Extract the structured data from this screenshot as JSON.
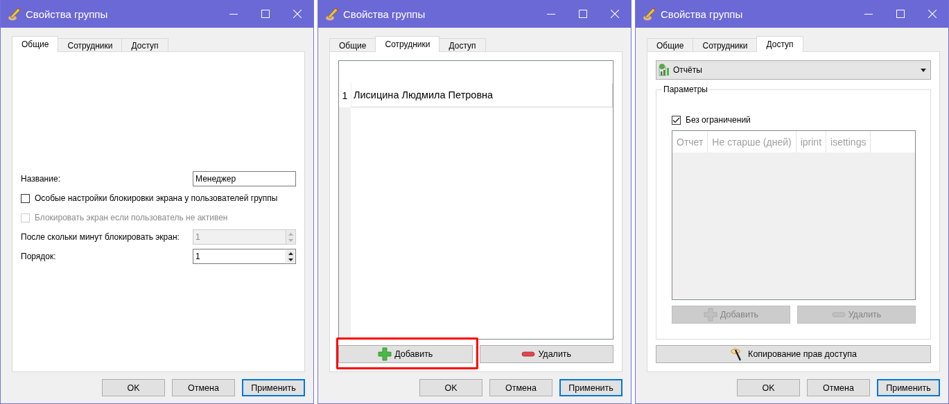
{
  "windows": [
    {
      "title": "Свойства группы",
      "tabs": [
        {
          "label": "Общие",
          "selected": true
        },
        {
          "label": "Сотрудники",
          "selected": false
        },
        {
          "label": "Доступ",
          "selected": false
        }
      ],
      "page": {
        "kind": "general",
        "fields": [
          {
            "kind": "text",
            "label": "Название:",
            "value": "Менеджер"
          },
          {
            "kind": "checkbox",
            "label": "Особые настройки блокировки экрана у пользователей группы",
            "checked": false,
            "disabled": false
          },
          {
            "kind": "checkbox",
            "label": "Блокировать экран если пользователь не активен",
            "checked": false,
            "disabled": true
          },
          {
            "kind": "spin",
            "label": "После скольки минут блокировать экран:",
            "value": "1",
            "disabled": true
          },
          {
            "kind": "spin",
            "label": "Порядок:",
            "value": "1",
            "disabled": false
          }
        ]
      },
      "buttons": [
        {
          "label": "OK",
          "focused": false
        },
        {
          "label": "Отмена",
          "focused": false
        },
        {
          "label": "Применить",
          "focused": true
        }
      ]
    },
    {
      "title": "Свойства группы",
      "tabs": [
        {
          "label": "Общие",
          "selected": false
        },
        {
          "label": "Сотрудники",
          "selected": true
        },
        {
          "label": "Доступ",
          "selected": false
        }
      ],
      "page": {
        "kind": "employees",
        "rows": [
          {
            "number": "1",
            "name": "Лисицина Людмила Петровна"
          }
        ],
        "actions": [
          {
            "kind": "add",
            "label": "Добавить",
            "disabled": false,
            "highlighted": true
          },
          {
            "kind": "remove",
            "label": "Удалить",
            "disabled": false,
            "highlighted": false
          }
        ]
      },
      "buttons": [
        {
          "label": "OK",
          "focused": false
        },
        {
          "label": "Отмена",
          "focused": false
        },
        {
          "label": "Применить",
          "focused": true
        }
      ]
    },
    {
      "title": "Свойства группы",
      "tabs": [
        {
          "label": "Общие",
          "selected": false
        },
        {
          "label": "Сотрудники",
          "selected": false
        },
        {
          "label": "Доступ",
          "selected": true
        }
      ],
      "page": {
        "kind": "access",
        "dropdown": "Отчёты",
        "group": {
          "title": "Параметры",
          "checkbox": {
            "label": "Без ограничений",
            "checked": true
          },
          "table": {
            "disabled": true,
            "columns": [
              "Отчет",
              "Не старше (дней)",
              "iprint",
              "isettings"
            ]
          },
          "actions": [
            {
              "kind": "add",
              "label": "Добавить",
              "disabled": true,
              "highlighted": false
            },
            {
              "kind": "remove",
              "label": "Удалить",
              "disabled": true,
              "highlighted": false
            }
          ]
        },
        "copy_button": "Копирование прав доступа"
      },
      "buttons": [
        {
          "label": "OK",
          "focused": false
        },
        {
          "label": "Отмена",
          "focused": false
        },
        {
          "label": "Применить",
          "focused": true
        }
      ]
    }
  ]
}
